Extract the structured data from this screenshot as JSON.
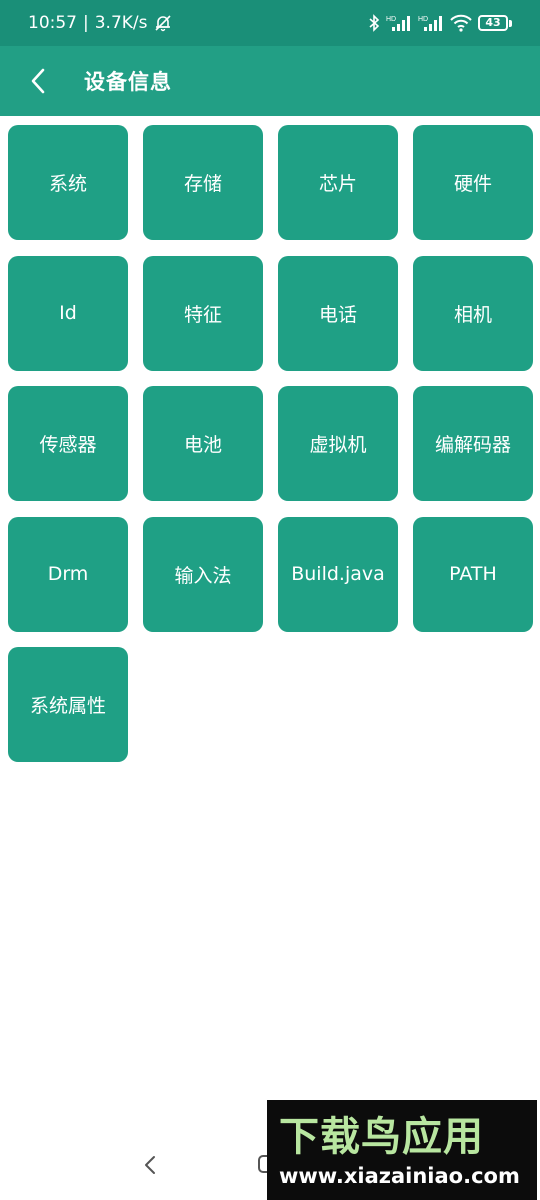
{
  "status_bar": {
    "time": "10:57",
    "separator": "|",
    "speed": "3.7K/s",
    "battery": "43",
    "icons": [
      "mute-bell-icon",
      "bluetooth-icon",
      "signal-hd-icon",
      "signal-hd-icon",
      "wifi-icon",
      "battery-icon"
    ]
  },
  "app_bar": {
    "title": "设备信息",
    "back_icon": "chevron-left-icon"
  },
  "tiles": [
    "系统",
    "存储",
    "芯片",
    "硬件",
    "Id",
    "特征",
    "电话",
    "相机",
    "传感器",
    "电池",
    "虚拟机",
    "编解码器",
    "Drm",
    "输入法",
    "Build.java",
    "PATH",
    "系统属性"
  ],
  "colors": {
    "status_bar": "#1a8f78",
    "app_bar": "#229f85",
    "tile": "#1fa085",
    "tile_text": "#ffffff",
    "background": "#ffffff"
  },
  "watermark": {
    "title": "下载鸟应用",
    "url": "www.xiazainiao.com"
  },
  "nav_bar": {
    "icons": [
      "nav-back-icon",
      "nav-home-icon"
    ]
  }
}
